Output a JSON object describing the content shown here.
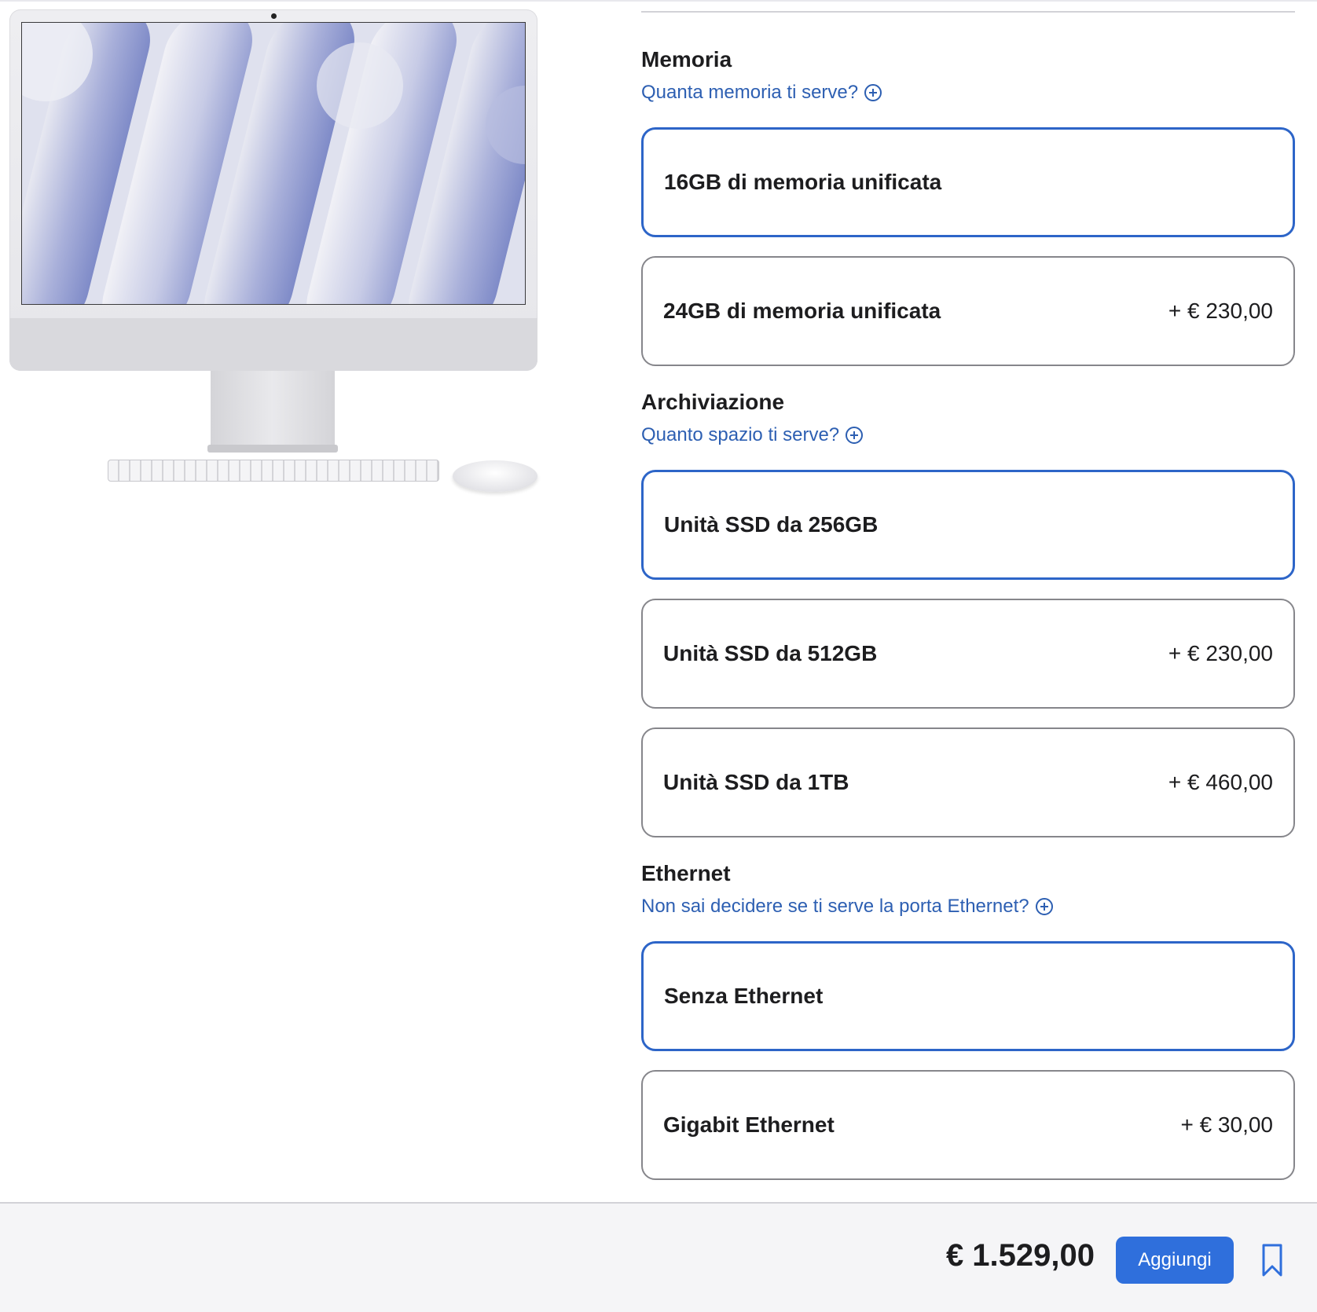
{
  "memory": {
    "title": "Memoria",
    "help": "Quanta memoria ti serve?",
    "options": [
      {
        "label": "16GB di memoria unificata",
        "price": "",
        "selected": true
      },
      {
        "label": "24GB di memoria unificata",
        "price": "+ € 230,00",
        "selected": false
      }
    ]
  },
  "storage": {
    "title": "Archiviazione",
    "help": "Quanto spazio ti serve?",
    "options": [
      {
        "label": "Unità SSD da 256GB",
        "price": "",
        "selected": true
      },
      {
        "label": "Unità SSD da 512GB",
        "price": "+ € 230,00",
        "selected": false
      },
      {
        "label": "Unità SSD da 1TB",
        "price": "+ € 460,00",
        "selected": false
      }
    ]
  },
  "ethernet": {
    "title": "Ethernet",
    "help": "Non sai decidere se ti serve la porta Ethernet?",
    "options": [
      {
        "label": "Senza Ethernet",
        "price": "",
        "selected": true
      },
      {
        "label": "Gigabit Ethernet",
        "price": "+ € 30,00",
        "selected": false
      }
    ]
  },
  "footer": {
    "total": "€ 1.529,00",
    "add_label": "Aggiungi"
  },
  "colors": {
    "accent": "#2f6fdc",
    "link": "#2d5fb2",
    "selected_border": "#2d65c8"
  }
}
